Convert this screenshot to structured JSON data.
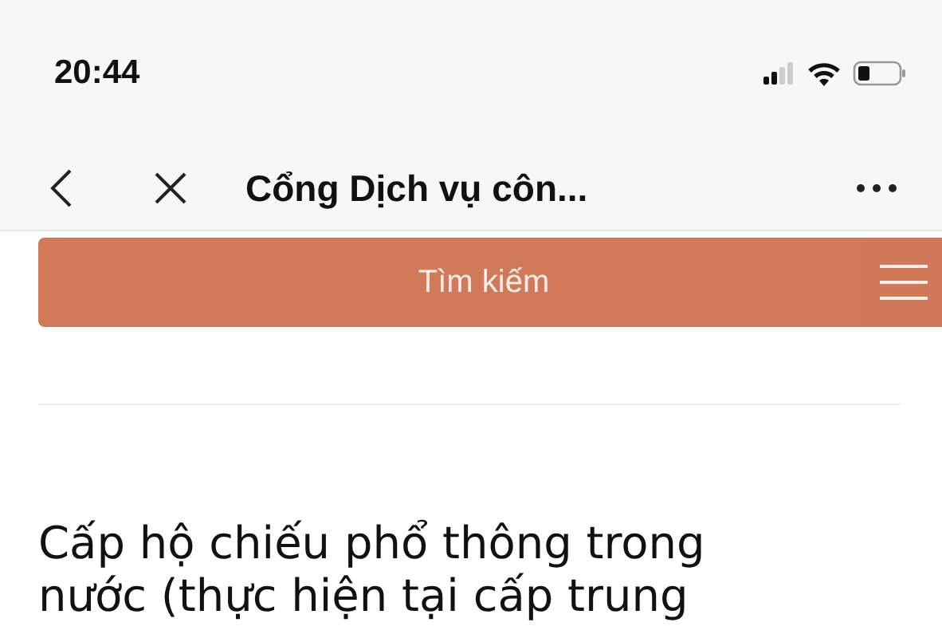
{
  "status_bar": {
    "time": "20:44"
  },
  "nav_bar": {
    "title": "Cổng Dịch vụ côn..."
  },
  "search_bar": {
    "label": "Tìm kiếm"
  },
  "heading": {
    "lines": [
      "Cấp hộ chiếu phổ thông trong",
      "nước (thực hiện tại cấp trung"
    ]
  }
}
